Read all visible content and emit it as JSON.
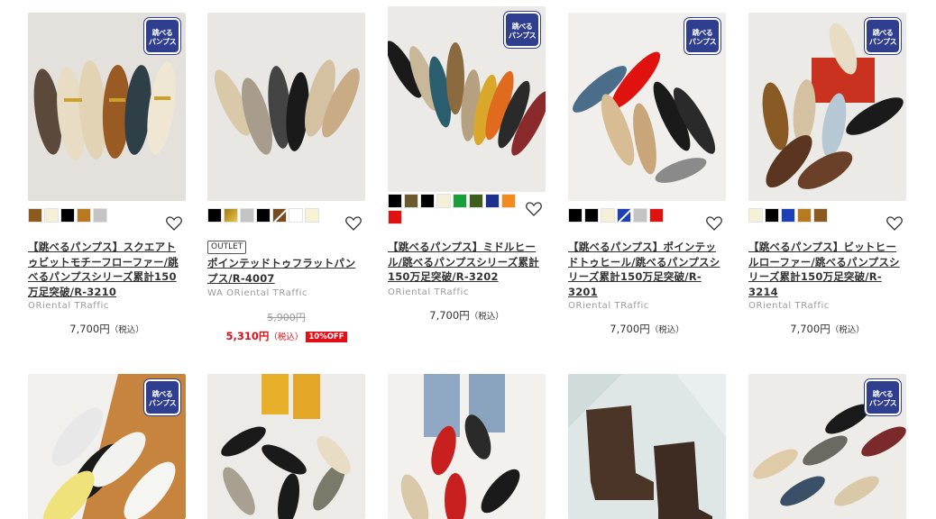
{
  "badge_text": "跳べるパンプス",
  "colors": {
    "sale": "#e40d17",
    "badge": "#2f3e8f"
  },
  "products": [
    {
      "title": "【跳べるパンプス】スクエアトゥビットモチーフローファー/跳べるパンプスシリーズ累計150万足突破/R-3210",
      "brand": "ORiental TRaffic",
      "price": "7,700円",
      "tax": "（税込）",
      "swatches": [
        "#8a5a1e",
        "#f5f0d8",
        "#000000",
        "#b87a1e",
        "#c4c4c4"
      ]
    },
    {
      "tag": "OUTLET",
      "title": "ポインテッドトゥフラットパンプス/R-4007",
      "brand": "WA ORiental TRaffic",
      "old_price": "5,900円",
      "price": "5,310円",
      "tax": "（税込）",
      "discount": "10%OFF",
      "swatches": [
        "#000000",
        "#c9a227",
        "#c4c4c4",
        "#000000",
        "#7a4a1e",
        "#ffffff",
        "#f8f3d2"
      ]
    },
    {
      "title": "【跳べるパンプス】ミドルヒール/跳べるパンプスシリーズ累計150万足突破/R-3202",
      "brand": "ORiental TRaffic",
      "price": "7,700円",
      "tax": "（税込）",
      "swatches": [
        "#000000",
        "#6b5a2e",
        "#000000",
        "#f5f0d8",
        "#1a9e3a",
        "#3f5e1a",
        "#1d2f8f",
        "#f28a1e",
        "#e0120f"
      ]
    },
    {
      "title": "【跳べるパンプス】ポインテッドトゥヒール/跳べるパンプスシリーズ累計150万足突破/R-3201",
      "brand": "ORiental TRaffic",
      "price": "7,700円",
      "tax": "（税込）",
      "swatches": [
        "#000000",
        "#000000",
        "#f5f0d8",
        "#1d3fb8",
        "#c4c4c4",
        "#e0120f"
      ]
    },
    {
      "title": "【跳べるパンプス】ビットヒールローファー/跳べるパンプスシリーズ累計150万足突破/R-3214",
      "brand": "ORiental TRaffic",
      "price": "7,700円",
      "tax": "（税込）",
      "swatches": [
        "#f5f0d8",
        "#000000",
        "#1d3fb8",
        "#b87a1e",
        "#8a5a1e"
      ]
    }
  ]
}
